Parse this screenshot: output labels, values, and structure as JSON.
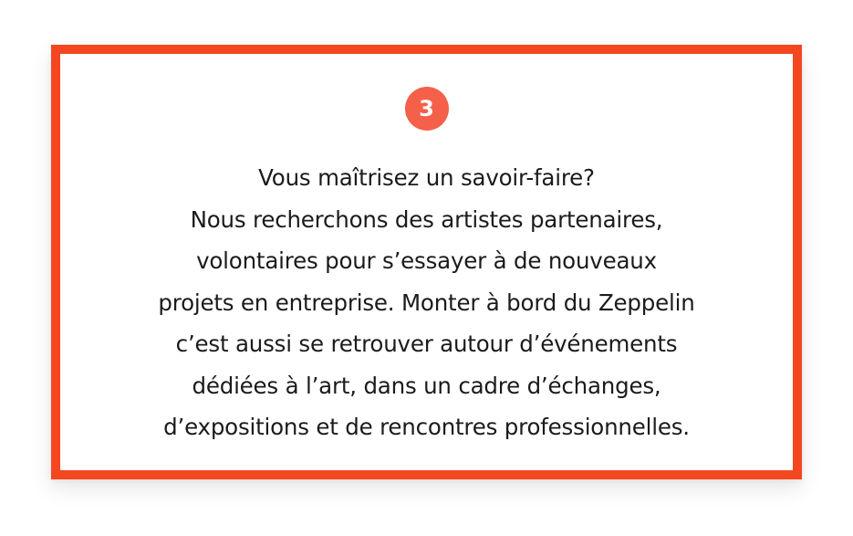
{
  "card": {
    "badge_number": "3",
    "lines": [
      "Vous maîtrisez un savoir-faire?",
      "Nous recherchons des artistes partenaires,",
      "volontaires pour s’essayer à de nouveaux",
      "projets en entreprise. Monter à bord du Zeppelin",
      "c’est aussi se retrouver autour d’événements",
      "dédiées à l’art, dans un cadre d’échanges,",
      "d’expositions et de rencontres professionnelles."
    ]
  },
  "colors": {
    "border": "#f4461f",
    "badge_background": "#f4604a",
    "badge_text": "#ffffff",
    "body_text": "#1b1b1b",
    "background": "#ffffff"
  }
}
